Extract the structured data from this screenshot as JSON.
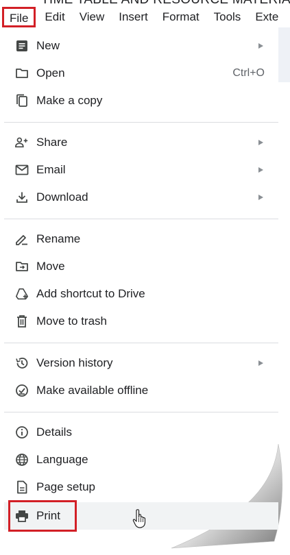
{
  "document": {
    "title_fragment": "TIME TABLE AND RESOURCE MATERIAL"
  },
  "menubar": {
    "items": [
      "File",
      "Edit",
      "View",
      "Insert",
      "Format",
      "Tools",
      "Exte"
    ]
  },
  "file_menu": {
    "new": {
      "label": "New"
    },
    "open": {
      "label": "Open",
      "shortcut": "Ctrl+O"
    },
    "make_copy": {
      "label": "Make a copy"
    },
    "share": {
      "label": "Share"
    },
    "email": {
      "label": "Email"
    },
    "download": {
      "label": "Download"
    },
    "rename": {
      "label": "Rename"
    },
    "move": {
      "label": "Move"
    },
    "add_shortcut": {
      "label": "Add shortcut to Drive"
    },
    "move_trash": {
      "label": "Move to trash"
    },
    "version_history": {
      "label": "Version history"
    },
    "offline": {
      "label": "Make available offline"
    },
    "details": {
      "label": "Details"
    },
    "language": {
      "label": "Language"
    },
    "page_setup": {
      "label": "Page setup"
    },
    "print": {
      "label": "Print"
    }
  },
  "colors": {
    "highlight": "#d21f26",
    "icon": "#444746",
    "hover_row": "#f1f3f4"
  }
}
